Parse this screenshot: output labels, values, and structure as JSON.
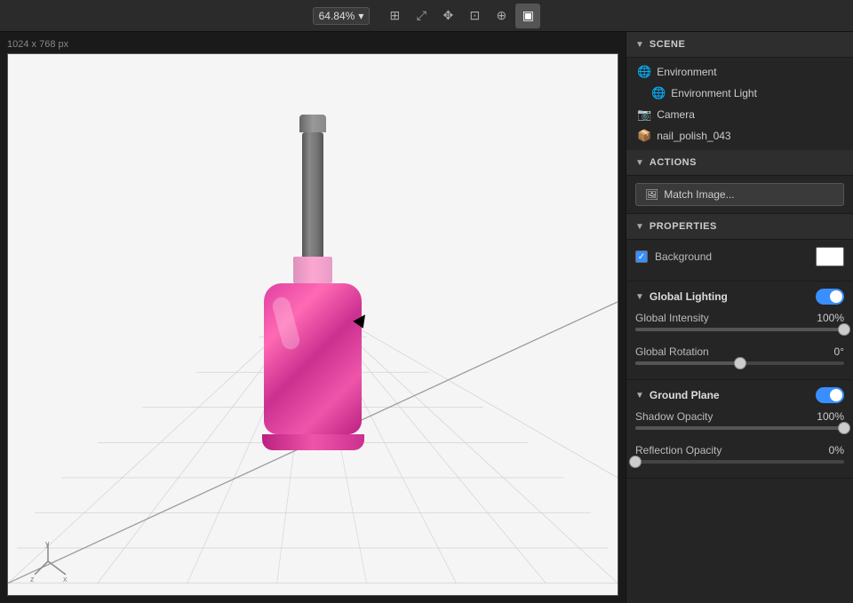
{
  "toolbar": {
    "zoom_label": "64.84%",
    "zoom_dropdown_icon": "▾",
    "icons": [
      {
        "name": "grid-icon",
        "symbol": "⊞"
      },
      {
        "name": "transform-icon",
        "symbol": "⤢"
      },
      {
        "name": "move-icon",
        "symbol": "✥"
      },
      {
        "name": "pivot-icon",
        "symbol": "⊕"
      },
      {
        "name": "add-icon",
        "symbol": "⊕"
      },
      {
        "name": "render-icon",
        "symbol": "▣"
      }
    ]
  },
  "viewport": {
    "dimensions_label": "1024 x 768 px"
  },
  "scene_panel": {
    "title": "SCENE",
    "items": [
      {
        "id": "environment",
        "label": "Environment",
        "icon": "globe",
        "level": 0
      },
      {
        "id": "environment-light",
        "label": "Environment Light",
        "icon": "globe",
        "level": 1
      },
      {
        "id": "camera",
        "label": "Camera",
        "icon": "camera",
        "level": 0
      },
      {
        "id": "nail-polish",
        "label": "nail_polish_043",
        "icon": "box",
        "level": 0
      }
    ]
  },
  "actions_panel": {
    "title": "ACTIONS",
    "match_image_label": "Match Image..."
  },
  "properties_panel": {
    "title": "PROPERTIES",
    "background_label": "Background",
    "background_checked": true
  },
  "global_lighting": {
    "title": "Global Lighting",
    "enabled": true,
    "global_intensity_label": "Global Intensity",
    "global_intensity_value": "100%",
    "global_intensity_percent": 100,
    "global_rotation_label": "Global Rotation",
    "global_rotation_value": "0°",
    "global_rotation_percent": 50
  },
  "ground_plane": {
    "title": "Ground Plane",
    "enabled": true,
    "shadow_opacity_label": "Shadow Opacity",
    "shadow_opacity_value": "100%",
    "shadow_opacity_percent": 100,
    "reflection_opacity_label": "Reflection Opacity",
    "reflection_opacity_value": "0%",
    "reflection_opacity_percent": 0
  }
}
